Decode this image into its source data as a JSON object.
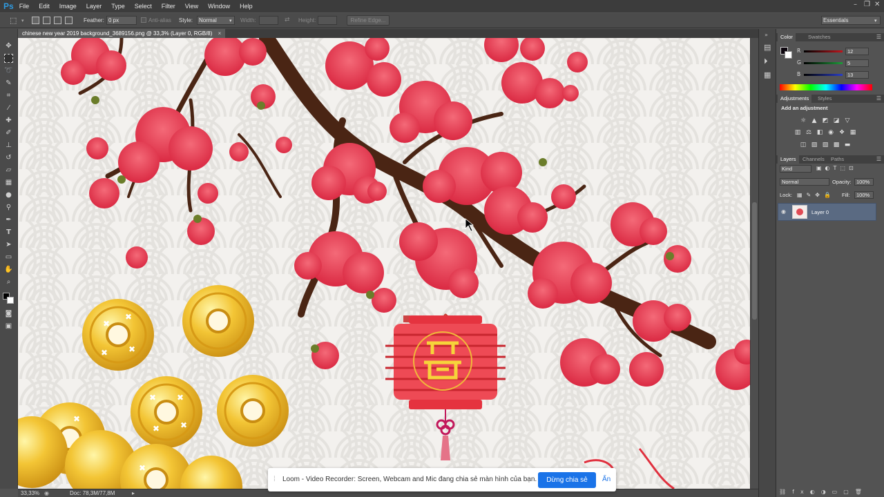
{
  "app": {
    "logo": "Ps"
  },
  "menu": [
    "File",
    "Edit",
    "Image",
    "Layer",
    "Type",
    "Select",
    "Filter",
    "View",
    "Window",
    "Help"
  ],
  "options": {
    "feather_label": "Feather:",
    "feather_value": "0 px",
    "antialias_label": "Anti-alias",
    "style_label": "Style:",
    "style_value": "Normal",
    "width_label": "Width:",
    "height_label": "Height:",
    "refine_edge": "Refine Edge...",
    "workspace": "Essentials"
  },
  "document": {
    "tab_title": "chinese new year 2019 background_3689156.png @ 33,3% (Layer 0, RGB/8)",
    "close_glyph": "×"
  },
  "status": {
    "zoom": "33,33%",
    "doc": "Doc: 78,3M/77,8M"
  },
  "color_panel": {
    "tabs": [
      "Color",
      "Swatches"
    ],
    "r_label": "R",
    "g_label": "G",
    "b_label": "B",
    "r": "12",
    "g": "5",
    "b": "13",
    "colors": {
      "r_track": "#c0151c",
      "g_track": "#1e9a3a",
      "b_track": "#2a3ec7"
    }
  },
  "adjustments_panel": {
    "tabs": [
      "Adjustments",
      "Styles"
    ],
    "heading": "Add an adjustment"
  },
  "layers_panel": {
    "tabs": [
      "Layers",
      "Channels",
      "Paths"
    ],
    "kind": "Kind",
    "blend_mode": "Normal",
    "opacity_label": "Opacity:",
    "opacity": "100%",
    "lock_label": "Lock:",
    "fill_label": "Fill:",
    "fill": "100%",
    "layer_name": "Layer 0"
  },
  "loom": {
    "message": "Loom - Video Recorder: Screen, Webcam and Mic đang chia sẻ màn hình của bạn.",
    "stop_button": "Dừng chia sẻ",
    "hide_button": "Ẩn",
    "accent": "#1a73e8"
  }
}
